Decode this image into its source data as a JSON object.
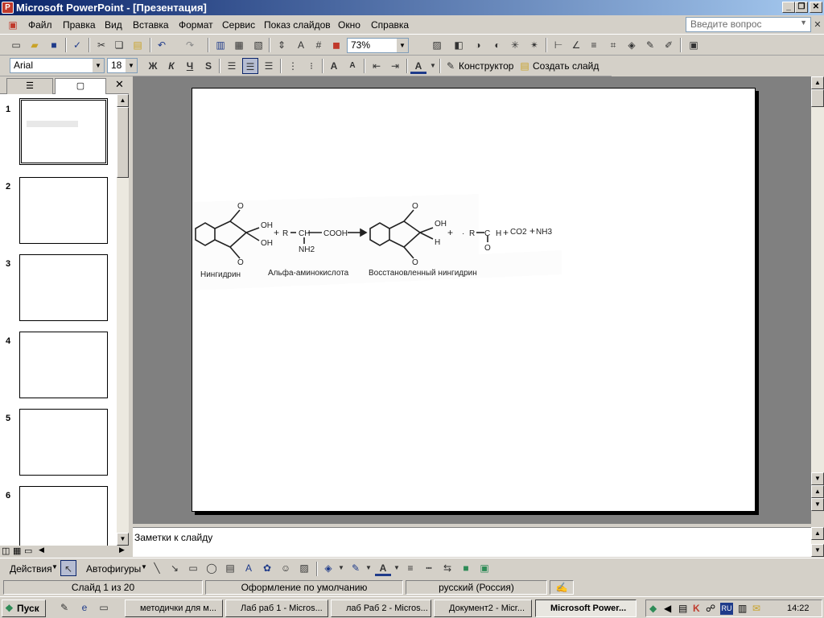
{
  "window": {
    "title": "Microsoft PowerPoint - [Презентация]"
  },
  "menu": [
    "Файл",
    "Правка",
    "Вид",
    "Вставка",
    "Формат",
    "Сервис",
    "Показ слайдов",
    "Окно",
    "Справка"
  ],
  "ask_placeholder": "Введите вопрос",
  "toolbar": {
    "zoom": "73%",
    "font": "Arial",
    "font_size": "18",
    "designer": "Конструктор",
    "new_slide": "Создать слайд"
  },
  "slides": {
    "numbers": [
      "1",
      "2",
      "3",
      "4",
      "5",
      "6"
    ]
  },
  "chem": {
    "labels": [
      "Нингидрин",
      "Альфа-аминокислота",
      "Восстановленный нингидрин"
    ],
    "formula": [
      "OH",
      "OH",
      "R",
      "CH",
      "COOH",
      "NH2",
      "OH",
      "H",
      "R",
      "C",
      "H",
      "O",
      "CO2",
      "NH3",
      "O",
      "O",
      "O",
      "O"
    ],
    "ops": [
      "+",
      "+",
      "+",
      "+",
      "·"
    ]
  },
  "notes": "Заметки к слайду",
  "drawbar": {
    "actions": "Действия",
    "autoshapes": "Автофигуры"
  },
  "status": {
    "slide": "Слайд 1 из 20",
    "design": "Оформление по умолчанию",
    "lang": "русский (Россия)"
  },
  "taskbar": {
    "start": "Пуск",
    "tasks": [
      "методички для м...",
      "Лаб раб 1 - Micros...",
      "лаб Раб 2 - Micros...",
      "Документ2 - Micr...",
      "Microsoft Power..."
    ],
    "lang": "RU",
    "clock": "14:22"
  }
}
